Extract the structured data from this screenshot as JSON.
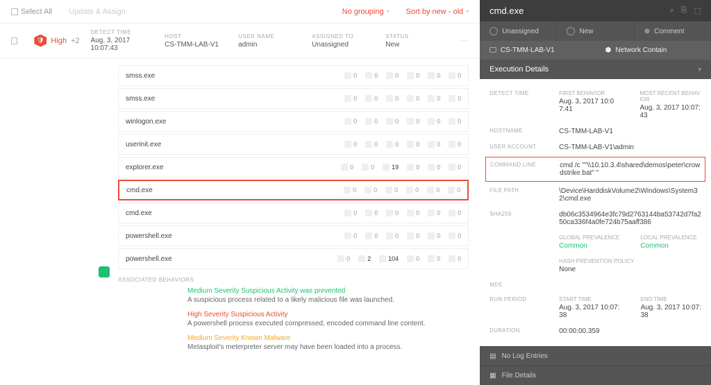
{
  "toolbar": {
    "select_all": "Select All",
    "update_assign": "Update & Assign",
    "grouping": "No grouping",
    "sort": "Sort by new - old"
  },
  "header": {
    "severity": "High",
    "extra": "+2",
    "cols": [
      {
        "label": "DETECT TIME",
        "value": "Aug. 3, 2017 10:07:43"
      },
      {
        "label": "HOST",
        "value": "CS-TMM-LAB-V1"
      },
      {
        "label": "USER NAME",
        "value": "admin"
      },
      {
        "label": "ASSIGNED TO",
        "value": "Unassigned"
      },
      {
        "label": "STATUS",
        "value": "New"
      }
    ]
  },
  "rows": [
    {
      "name": "smss.exe",
      "s": [
        "0",
        "0",
        "0",
        "0",
        "0",
        "0"
      ]
    },
    {
      "name": "smss.exe",
      "s": [
        "0",
        "0",
        "0",
        "0",
        "0",
        "0"
      ]
    },
    {
      "name": "winlogon.exe",
      "s": [
        "0",
        "0",
        "0",
        "0",
        "0",
        "0"
      ]
    },
    {
      "name": "userinit.exe",
      "s": [
        "0",
        "0",
        "0",
        "0",
        "0",
        "0"
      ]
    },
    {
      "name": "explorer.exe",
      "s": [
        "0",
        "0",
        "19",
        "0",
        "0",
        "0"
      ]
    },
    {
      "name": "cmd.exe",
      "s": [
        "0",
        "0",
        "0",
        "0",
        "0",
        "0"
      ],
      "sel": true
    },
    {
      "name": "cmd.exe",
      "s": [
        "0",
        "0",
        "0",
        "0",
        "0",
        "0"
      ]
    },
    {
      "name": "powershell.exe",
      "s": [
        "0",
        "0",
        "0",
        "0",
        "0",
        "0"
      ]
    },
    {
      "name": "powershell.exe",
      "s": [
        "0",
        "2",
        "104",
        "0",
        "0",
        "0"
      ]
    }
  ],
  "assoc_label": "ASSOCIATED BEHAVIORS",
  "behaviors": [
    {
      "cls": "med",
      "title": "Medium Severity Suspicious Activity was prevented",
      "desc": "A suspicious process related to a likely malicious file was launched."
    },
    {
      "cls": "high",
      "title": "High Severity Suspicious Activity",
      "desc": "A powershell process executed compressed, encoded command line content."
    },
    {
      "cls": "mal",
      "title": "Medium Severity Known Malware",
      "desc": "Metasploit's meterpreter server may have been loaded into a process."
    }
  ],
  "side": {
    "title": "cmd.exe",
    "unassigned": "Unassigned",
    "new": "New",
    "comment": "Comment",
    "host": "CS-TMM-LAB-V1",
    "contain": "Network Contain",
    "exec_header": "Execution Details",
    "detect_time_label": "DETECT TIME",
    "first_b_label": "FIRST BEHAVIOR",
    "first_b": "Aug. 3, 2017 10:07:41",
    "recent_b_label": "MOST RECENT BEHAVIOR",
    "recent_b": "Aug. 3, 2017 10:07:43",
    "hostname_label": "HOSTNAME",
    "hostname": "CS-TMM-LAB-V1",
    "user_label": "USER ACCOUNT",
    "user": "CS-TMM-LAB-V1\\admin",
    "cmd_label": "COMMAND LINE",
    "cmd": "cmd /c \"\"\\\\10.10.3.4\\shared\\demos\\peter\\crowdstrike.bat\" \"",
    "path_label": "FILE PATH",
    "path": "\\Device\\HarddiskVolume2\\Windows\\System32\\cmd.exe",
    "sha_label": "SHA256",
    "sha": "db06c3534964e3fc79d2763144ba53742d7fa250ca336f4a0fe724b75aaff386",
    "gp_label": "GLOBAL PREVALENCE",
    "gp": "Common",
    "lp_label": "LOCAL PREVALENCE",
    "lp": "Common",
    "hpp_label": "HASH PREVENTION POLICY",
    "hpp": "None",
    "md5_label": "MD5",
    "run_label": "RUN PERIOD",
    "start_label": "START TIME",
    "start": "Aug. 3, 2017 10:07:38",
    "end_label": "END TIME",
    "end": "Aug. 3, 2017 10:07:38",
    "dur_label": "DURATION",
    "dur": "00:00:00.359",
    "nolog": "No Log Entries",
    "filedet": "File Details"
  }
}
